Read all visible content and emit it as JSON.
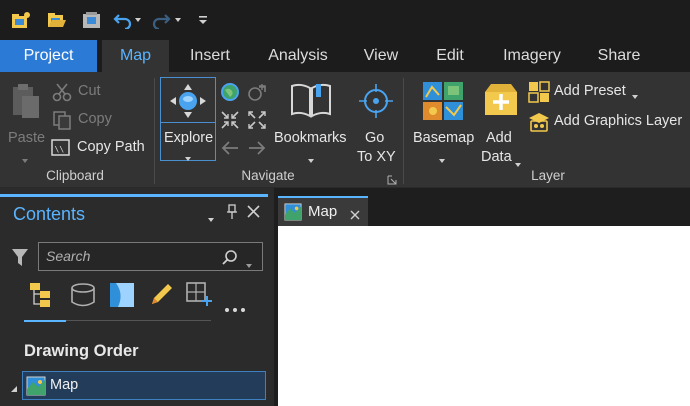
{
  "quick_access": {
    "icons": [
      "new-project-icon",
      "open-project-icon",
      "save-project-icon",
      "undo-icon",
      "redo-icon",
      "customize-qat-icon"
    ]
  },
  "tabs": [
    {
      "label": "Project"
    },
    {
      "label": "Map"
    },
    {
      "label": "Insert"
    },
    {
      "label": "Analysis"
    },
    {
      "label": "View"
    },
    {
      "label": "Edit"
    },
    {
      "label": "Imagery"
    },
    {
      "label": "Share"
    }
  ],
  "ribbon": {
    "clipboard": {
      "group_label": "Clipboard",
      "paste": "Paste",
      "cut": "Cut",
      "copy": "Copy",
      "copy_path": "Copy Path"
    },
    "navigate": {
      "group_label": "Navigate",
      "explore": "Explore",
      "bookmarks": "Bookmarks",
      "goto_line1": "Go",
      "goto_line2": "To XY"
    },
    "layer": {
      "group_label": "Layer",
      "basemap": "Basemap",
      "add_data_line1": "Add",
      "add_data_line2": "Data",
      "add_preset": "Add Preset",
      "add_graphics_layer": "Add Graphics Layer"
    }
  },
  "contents": {
    "title": "Contents",
    "search_placeholder": "Search",
    "section_heading": "Drawing Order",
    "tree": [
      {
        "label": "Map"
      }
    ]
  },
  "view_tab": {
    "label": "Map"
  },
  "colors": {
    "accent": "#5ab4ff",
    "project_tab": "#2b7bd6",
    "ribbon_bg": "#333333",
    "pane_bg": "#2b2b2b"
  }
}
